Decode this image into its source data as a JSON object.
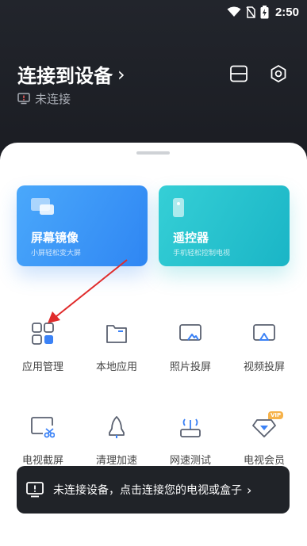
{
  "status_bar": {
    "time": "2:50",
    "battery_level": "⚡"
  },
  "header": {
    "title": "连接到设备",
    "title_chevron": "›",
    "status": "未连接"
  },
  "cards": [
    {
      "title": "屏幕镜像",
      "subtitle": "小屏轻松变大屏",
      "color": "#3a96f6"
    },
    {
      "title": "遥控器",
      "subtitle": "手机轻松控制电视",
      "color": "#27c0cd"
    }
  ],
  "grid": {
    "row1": [
      {
        "label": "应用管理",
        "icon": "apps-grid-icon"
      },
      {
        "label": "本地应用",
        "icon": "folder-icon"
      },
      {
        "label": "照片投屏",
        "icon": "photo-cast-icon"
      },
      {
        "label": "视频投屏",
        "icon": "video-cast-icon"
      }
    ],
    "row2": [
      {
        "label": "电视截屏",
        "icon": "tv-screenshot-icon"
      },
      {
        "label": "清理加速",
        "icon": "rocket-icon"
      },
      {
        "label": "网速测试",
        "icon": "router-icon"
      },
      {
        "label": "电视会员",
        "icon": "vip-diamond-icon",
        "badge": "VIP"
      }
    ]
  },
  "toast": {
    "text": "未连接设备，点击连接您的电视或盒子",
    "chevron": "›"
  },
  "colors": {
    "accent": "#3b82f6",
    "annotation_arrow": "#e02b2b"
  }
}
